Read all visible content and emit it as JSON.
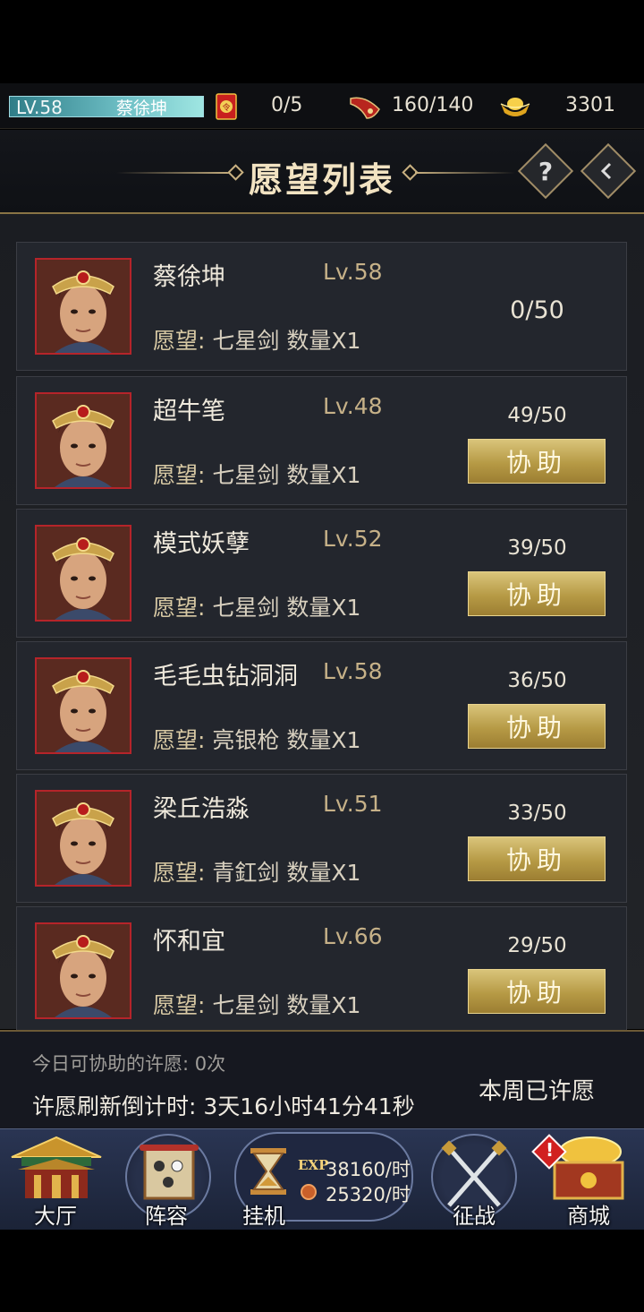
{
  "topbar": {
    "level": "LV.58",
    "player_name": "蔡徐坤",
    "wish_count": "0/5",
    "energy": "160/140",
    "gold": "3301",
    "icons": [
      "red-envelope-icon",
      "horn-energy-icon",
      "gold-ingot-icon"
    ]
  },
  "header": {
    "title": "愿望列表",
    "help_label": "?",
    "back_icon": "diamond-back-icon"
  },
  "wishes": [
    {
      "name": "蔡徐坤",
      "level": "Lv.58",
      "wish_label": "愿望:",
      "wish_item": "七星剑 数量X1",
      "progress": "0/50",
      "help": ""
    },
    {
      "name": "超牛笔",
      "level": "Lv.48",
      "wish_label": "愿望:",
      "wish_item": "七星剑 数量X1",
      "progress": "49/50",
      "help": "协助"
    },
    {
      "name": "模式妖孽",
      "level": "Lv.52",
      "wish_label": "愿望:",
      "wish_item": "七星剑 数量X1",
      "progress": "39/50",
      "help": "协助"
    },
    {
      "name": "毛毛虫钻洞洞",
      "level": "Lv.58",
      "wish_label": "愿望:",
      "wish_item": "亮银枪 数量X1",
      "progress": "36/50",
      "help": "协助"
    },
    {
      "name": "梁丘浩淼",
      "level": "Lv.51",
      "wish_label": "愿望:",
      "wish_item": "青釭剑 数量X1",
      "progress": "33/50",
      "help": "协助"
    },
    {
      "name": "怀和宜",
      "level": "Lv.66",
      "wish_label": "愿望:",
      "wish_item": "七星剑 数量X1",
      "progress": "29/50",
      "help": "协助"
    }
  ],
  "info": {
    "daily_assist": "今日可协助的许愿: 0次",
    "refresh_countdown": "许愿刷新倒计时: 3天16小时41分41秒",
    "weekly_status": "本周已许愿"
  },
  "nav": {
    "hall": "大厅",
    "lineup": "阵容",
    "idle": "挂机",
    "idle_exp_tag": "EXP",
    "idle_exp": "38160/时",
    "idle_coin": "25320/时",
    "campaign": "征战",
    "shop": "商城"
  },
  "colors": {
    "gold_button": "#c4aa5c",
    "avatar_border": "#b5242a",
    "header_line": "#8a7445"
  }
}
